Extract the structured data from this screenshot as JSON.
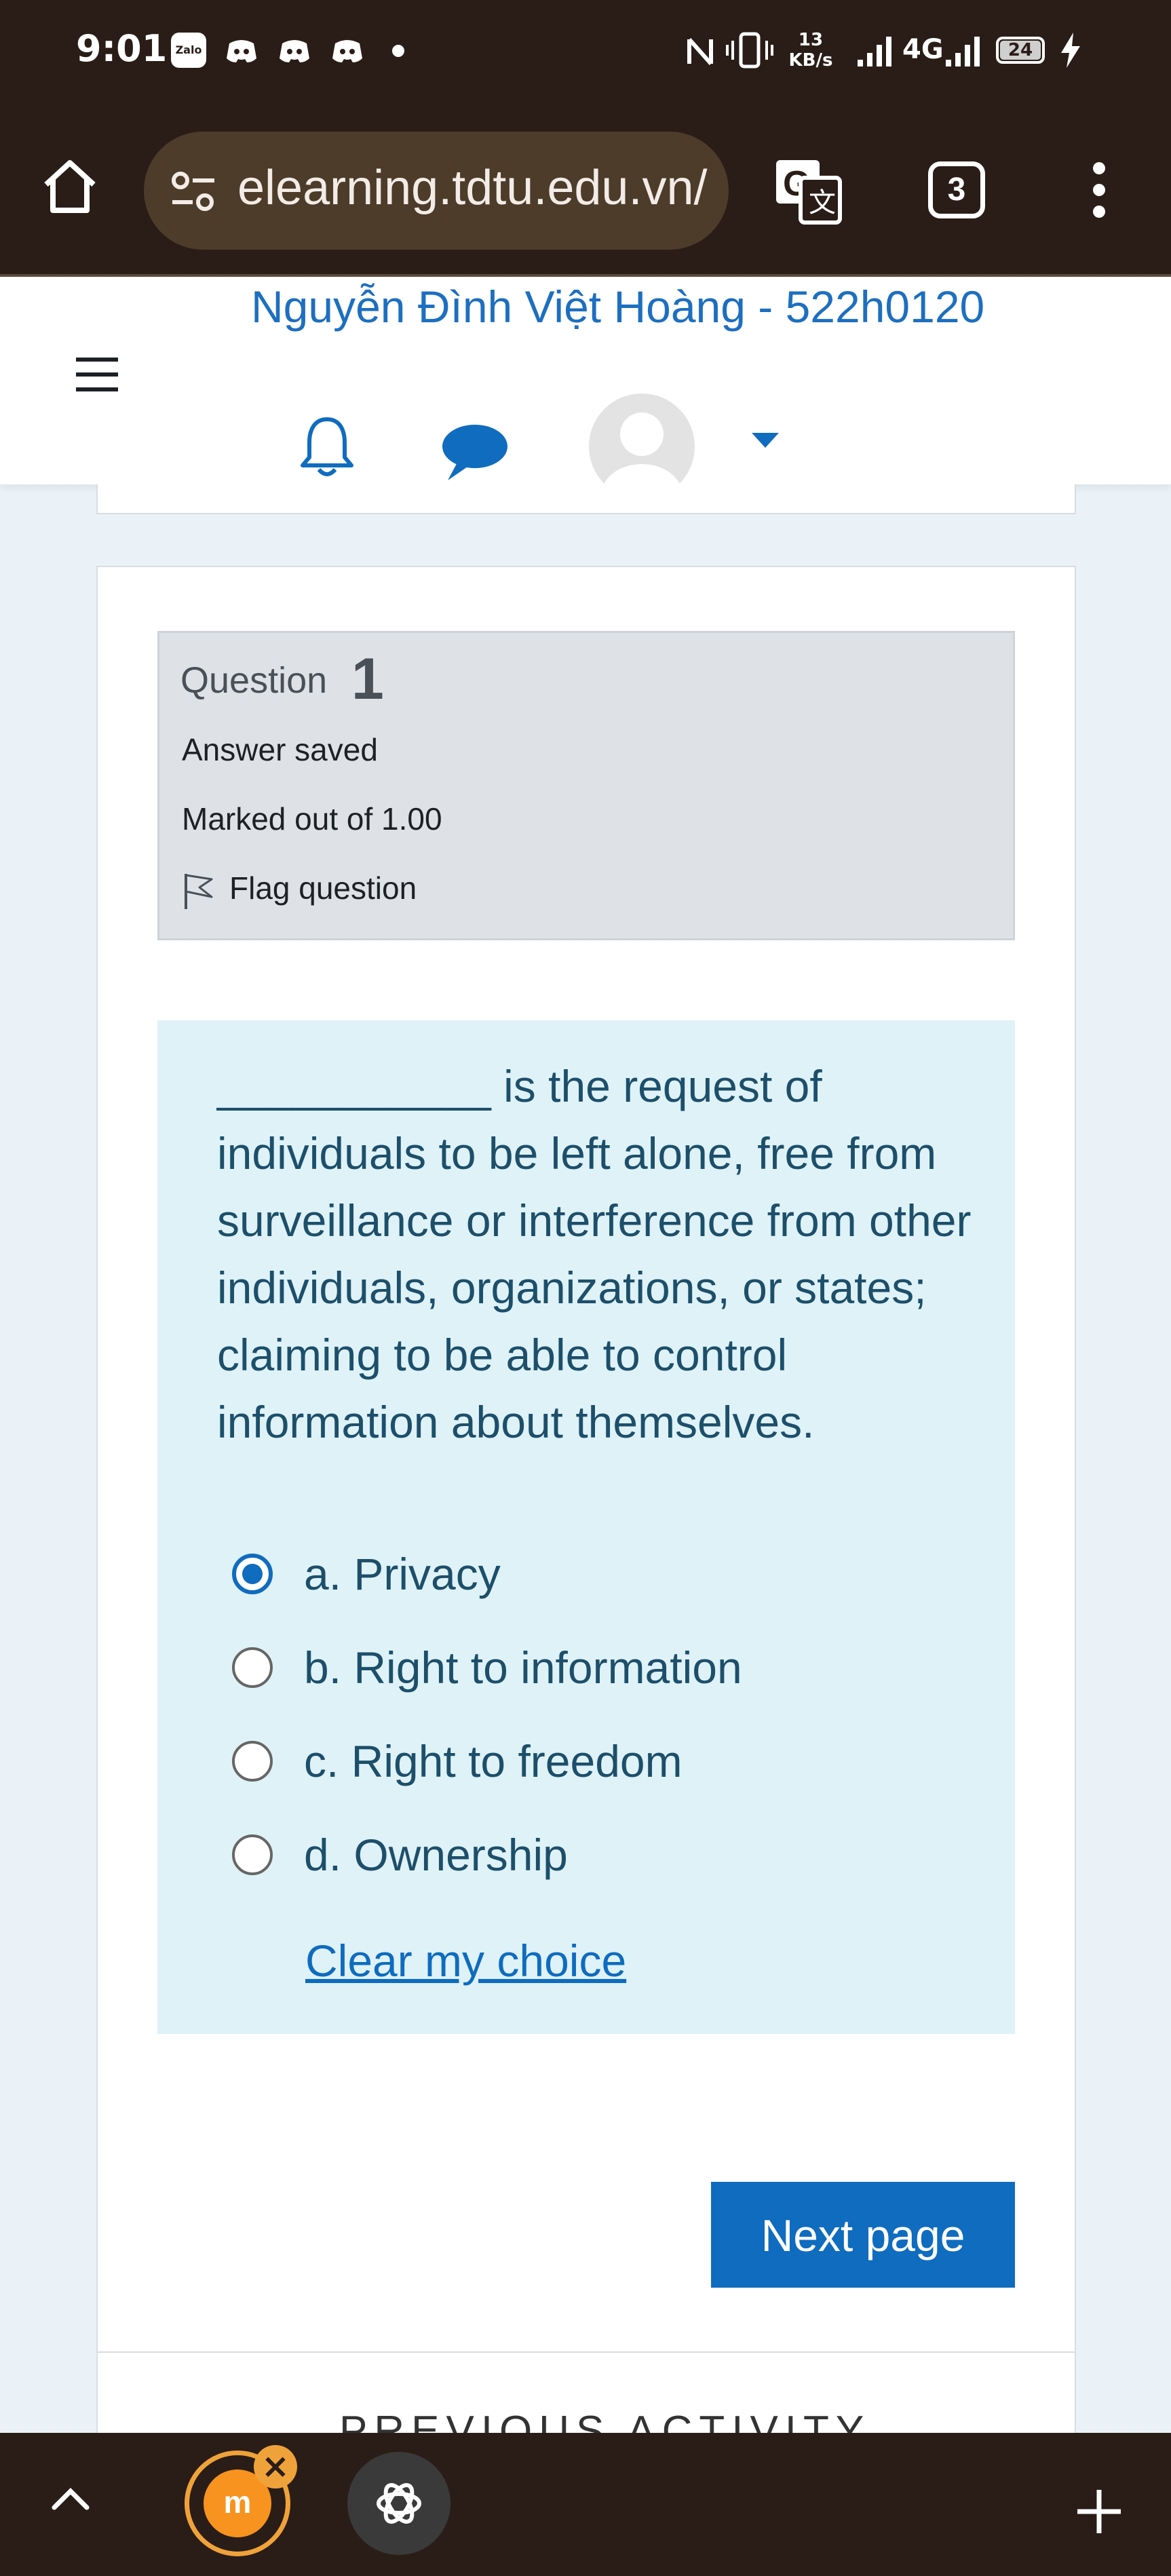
{
  "status_bar": {
    "time": "9:01",
    "app_icons": [
      "zalo-icon",
      "discord-icon",
      "discord-icon",
      "discord-icon",
      "dot-icon"
    ],
    "zalo_label": "Zalo",
    "net_speed_value": "13",
    "net_speed_unit": "KB/s",
    "network": "4G",
    "battery": "24"
  },
  "browser": {
    "url": "elearning.tdtu.edu.vn/",
    "tab_count": "3",
    "icons": [
      "home-icon",
      "site-settings-icon",
      "translate-icon",
      "tabs-icon",
      "more-icon"
    ]
  },
  "header": {
    "user_name": "Nguyễn Đình Việt Hoàng - 522h0120",
    "icons": [
      "menu-icon",
      "bell-icon",
      "chat-icon",
      "avatar",
      "chevron-down-icon"
    ]
  },
  "question_info": {
    "label": "Question",
    "number": "1",
    "state": "Answer saved",
    "grade": "Marked out of 1.00",
    "flag_label": "Flag question"
  },
  "question": {
    "text": "___________ is the request of individuals to be left alone, free from surveillance or interference from other individuals, organizations, or states; claiming to be able to control information about themselves.",
    "options": [
      {
        "label": "a. Privacy",
        "selected": true
      },
      {
        "label": "b. Right to information",
        "selected": false
      },
      {
        "label": "c. Right to freedom",
        "selected": false
      },
      {
        "label": "d. Ownership",
        "selected": false
      }
    ],
    "clear_label": "Clear my choice"
  },
  "navigation": {
    "next_label": "Next page",
    "previous_activity_label": "PREVIOUS ACTIVITY"
  },
  "colors": {
    "accent": "#0f6cbf",
    "status_bar_bg": "#2a1d17",
    "question_bg": "#def2f8",
    "info_bg": "#dee2e6"
  }
}
